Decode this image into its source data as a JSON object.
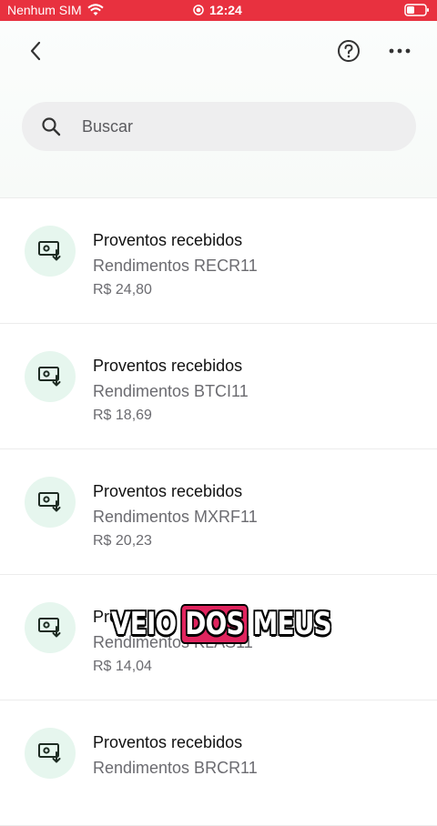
{
  "status_bar": {
    "carrier": "Nenhum SIM",
    "time": "12:24",
    "icons": [
      "wifi-icon",
      "record-icon",
      "battery-icon"
    ],
    "color": "#e8313f"
  },
  "header": {
    "icons": [
      "chevron-left-icon",
      "help-icon",
      "more-icon"
    ]
  },
  "search": {
    "placeholder": "Buscar",
    "icon": "search-icon"
  },
  "list": {
    "items": [
      {
        "title": "Proventos recebidos",
        "subtitle": "Rendimentos RECR11",
        "amount": "R$ 24,80",
        "icon": "money-receive-icon"
      },
      {
        "title": "Proventos recebidos",
        "subtitle": "Rendimentos BTCI11",
        "amount": "R$ 18,69",
        "icon": "money-receive-icon"
      },
      {
        "title": "Proventos recebidos",
        "subtitle": "Rendimentos MXRF11",
        "amount": "R$ 20,23",
        "icon": "money-receive-icon"
      },
      {
        "title": "Pro",
        "subtitle": "Rendimentos KLAS11",
        "amount": "R$ 14,04",
        "icon": "money-receive-icon"
      },
      {
        "title": "Proventos recebidos",
        "subtitle": "Rendimentos BRCR11",
        "amount": "",
        "icon": "money-receive-icon"
      }
    ]
  },
  "caption": {
    "word1": "VEIO",
    "word2": "DOS",
    "word3": "MEUS",
    "highlight_color": "#e0245e"
  }
}
